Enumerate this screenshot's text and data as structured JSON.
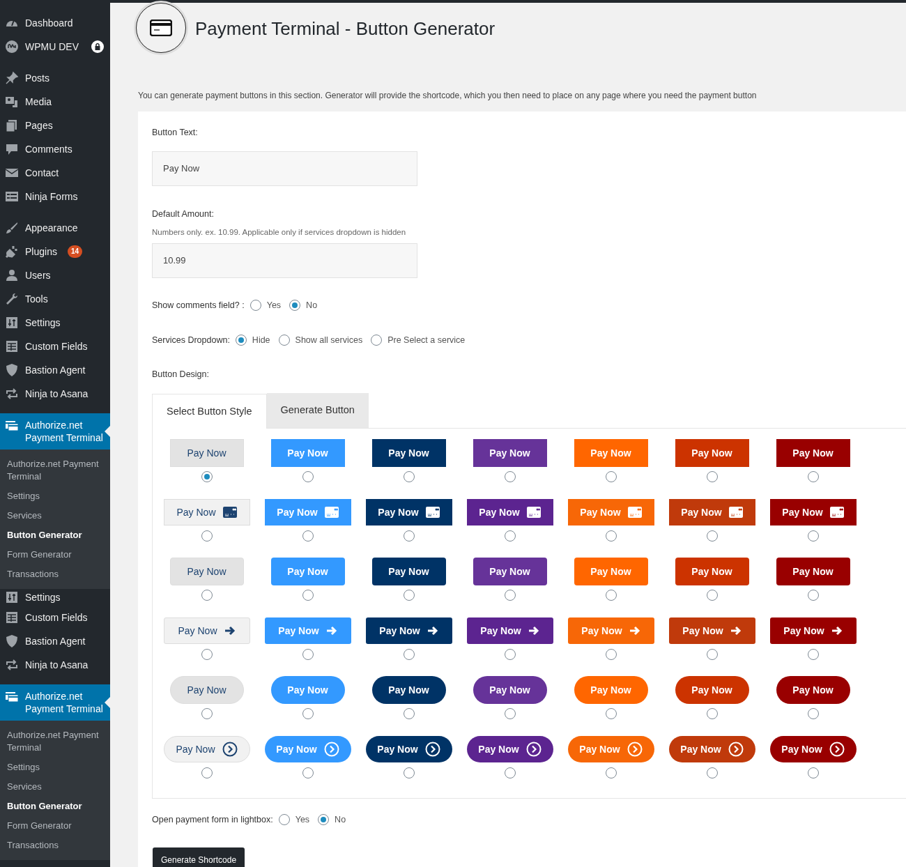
{
  "sidebar": {
    "sections": [
      {
        "items": [
          {
            "label": "Dashboard",
            "selected": false
          },
          {
            "label": "WPMU DEV",
            "selected": false,
            "locked": true
          }
        ]
      },
      {
        "items": [
          {
            "label": "Posts",
            "selected": false
          },
          {
            "label": "Media",
            "selected": false
          },
          {
            "label": "Pages",
            "selected": false
          },
          {
            "label": "Comments",
            "selected": false
          },
          {
            "label": "Contact",
            "selected": false
          },
          {
            "label": "Ninja Forms",
            "selected": false
          }
        ]
      },
      {
        "items": [
          {
            "label": "Appearance",
            "selected": false
          },
          {
            "label": "Plugins",
            "selected": false,
            "badge": "14"
          },
          {
            "label": "Users",
            "selected": false
          },
          {
            "label": "Tools",
            "selected": false
          },
          {
            "label": "Settings",
            "selected": false
          },
          {
            "label": "Custom Fields",
            "selected": false
          },
          {
            "label": "Bastion Agent",
            "selected": false
          },
          {
            "label": "Ninja to Asana",
            "selected": false
          }
        ]
      },
      {
        "items": [
          {
            "label": "Authorize.net Payment Terminal",
            "selected": true,
            "children": [
              {
                "label": "Authorize.net Payment Terminal",
                "selected": false
              },
              {
                "label": "Settings",
                "selected": false
              },
              {
                "label": "Services",
                "selected": false
              },
              {
                "label": "Button Generator",
                "selected": true
              },
              {
                "label": "Form Generator",
                "selected": false
              },
              {
                "label": "Transactions",
                "selected": false
              }
            ]
          }
        ]
      },
      {
        "items": [
          {
            "label": "Settings",
            "selected": false
          },
          {
            "label": "Custom Fields",
            "selected": false
          },
          {
            "label": "Bastion Agent",
            "selected": false
          },
          {
            "label": "Ninja to Asana",
            "selected": false
          }
        ]
      },
      {
        "items": [
          {
            "label": "Authorize.net Payment Terminal",
            "selected": true,
            "children": [
              {
                "label": "Authorize.net Payment Terminal",
                "selected": false
              },
              {
                "label": "Settings",
                "selected": false
              },
              {
                "label": "Services",
                "selected": false
              },
              {
                "label": "Button Generator",
                "selected": true
              },
              {
                "label": "Form Generator",
                "selected": false
              },
              {
                "label": "Transactions",
                "selected": false
              }
            ]
          }
        ]
      }
    ]
  },
  "header": {
    "title": "Payment Terminal - Button Generator",
    "description": "You can generate payment buttons in this section. Generator will provide the shortcode, which you then need to place on any page where you need the payment button"
  },
  "form": {
    "button_text": {
      "label": "Button Text:",
      "value": "Pay Now"
    },
    "default_amount": {
      "label": "Default Amount:",
      "hint": "Numbers only. ex. 10.99. Applicable only if services dropdown is hidden",
      "value": "10.99"
    },
    "show_comments": {
      "label": "Show comments field? :",
      "options": [
        {
          "label": "Yes",
          "selected": false
        },
        {
          "label": "No",
          "selected": true
        }
      ]
    },
    "services_dropdown": {
      "label": "Services Dropdown:",
      "options": [
        {
          "label": "Hide",
          "selected": true
        },
        {
          "label": "Show all services",
          "selected": false
        },
        {
          "label": "Pre Select a service",
          "selected": false
        }
      ]
    },
    "button_design": {
      "label": "Button Design:",
      "tabs": [
        {
          "label": "Select Button Style",
          "selected": true
        },
        {
          "label": "Generate Button",
          "selected": false
        }
      ],
      "styles": [
        {
          "kind": "flat",
          "buttons": [
            {
              "label": "Pay Now",
              "color": "#e3e3e3",
              "selected": true
            },
            {
              "label": "Pay Now",
              "color": "#3399ff",
              "selected": false
            },
            {
              "label": "Pay Now",
              "color": "#003366",
              "selected": false
            },
            {
              "label": "Pay Now",
              "color": "#663399",
              "selected": false
            },
            {
              "label": "Pay Now",
              "color": "#ff6600",
              "selected": false
            },
            {
              "label": "Pay Now",
              "color": "#cc3300",
              "selected": false
            },
            {
              "label": "Pay Now",
              "color": "#990000",
              "selected": false
            }
          ]
        },
        {
          "kind": "card",
          "buttons": [
            {
              "label": "Pay Now",
              "color": "#f1f1f1",
              "selected": false
            },
            {
              "label": "Pay Now",
              "color": "#3399ff",
              "selected": false
            },
            {
              "label": "Pay Now",
              "color": "#003366",
              "selected": false
            },
            {
              "label": "Pay Now",
              "color": "#5c2490",
              "selected": false
            },
            {
              "label": "Pay Now",
              "color": "#f76707",
              "selected": false
            },
            {
              "label": "Pay Now",
              "color": "#c03a0b",
              "selected": false
            },
            {
              "label": "Pay Now",
              "color": "#990000",
              "selected": false
            }
          ]
        },
        {
          "kind": "rounded",
          "buttons": [
            {
              "label": "Pay Now",
              "color": "#e3e3e3",
              "selected": false
            },
            {
              "label": "Pay Now",
              "color": "#3399ff",
              "selected": false
            },
            {
              "label": "Pay Now",
              "color": "#003366",
              "selected": false
            },
            {
              "label": "Pay Now",
              "color": "#663399",
              "selected": false
            },
            {
              "label": "Pay Now",
              "color": "#ff6600",
              "selected": false
            },
            {
              "label": "Pay Now",
              "color": "#cc3300",
              "selected": false
            },
            {
              "label": "Pay Now",
              "color": "#990000",
              "selected": false
            }
          ]
        },
        {
          "kind": "arrow",
          "buttons": [
            {
              "label": "Pay Now",
              "color": "#f1f1f1",
              "selected": false
            },
            {
              "label": "Pay Now",
              "color": "#3399ff",
              "selected": false
            },
            {
              "label": "Pay Now",
              "color": "#003366",
              "selected": false
            },
            {
              "label": "Pay Now",
              "color": "#5c2490",
              "selected": false
            },
            {
              "label": "Pay Now",
              "color": "#f76707",
              "selected": false
            },
            {
              "label": "Pay Now",
              "color": "#c03a0b",
              "selected": false
            },
            {
              "label": "Pay Now",
              "color": "#990000",
              "selected": false
            }
          ]
        },
        {
          "kind": "pill",
          "buttons": [
            {
              "label": "Pay Now",
              "color": "#e3e3e3",
              "selected": false
            },
            {
              "label": "Pay Now",
              "color": "#3399ff",
              "selected": false
            },
            {
              "label": "Pay Now",
              "color": "#003366",
              "selected": false
            },
            {
              "label": "Pay Now",
              "color": "#663399",
              "selected": false
            },
            {
              "label": "Pay Now",
              "color": "#ff6600",
              "selected": false
            },
            {
              "label": "Pay Now",
              "color": "#cc3300",
              "selected": false
            },
            {
              "label": "Pay Now",
              "color": "#990000",
              "selected": false
            }
          ]
        },
        {
          "kind": "pill_chevron",
          "buttons": [
            {
              "label": "Pay Now",
              "color": "#f1f1f1",
              "selected": false
            },
            {
              "label": "Pay Now",
              "color": "#3399ff",
              "selected": false
            },
            {
              "label": "Pay Now",
              "color": "#003366",
              "selected": false
            },
            {
              "label": "Pay Now",
              "color": "#5c2490",
              "selected": false
            },
            {
              "label": "Pay Now",
              "color": "#f76707",
              "selected": false
            },
            {
              "label": "Pay Now",
              "color": "#c03a0b",
              "selected": false
            },
            {
              "label": "Pay Now",
              "color": "#990000",
              "selected": false
            }
          ]
        }
      ]
    },
    "lightbox": {
      "label": "Open payment form in lightbox:",
      "options": [
        {
          "label": "Yes",
          "selected": false
        },
        {
          "label": "No",
          "selected": true
        }
      ]
    },
    "submit": "Generate Shortcode"
  }
}
